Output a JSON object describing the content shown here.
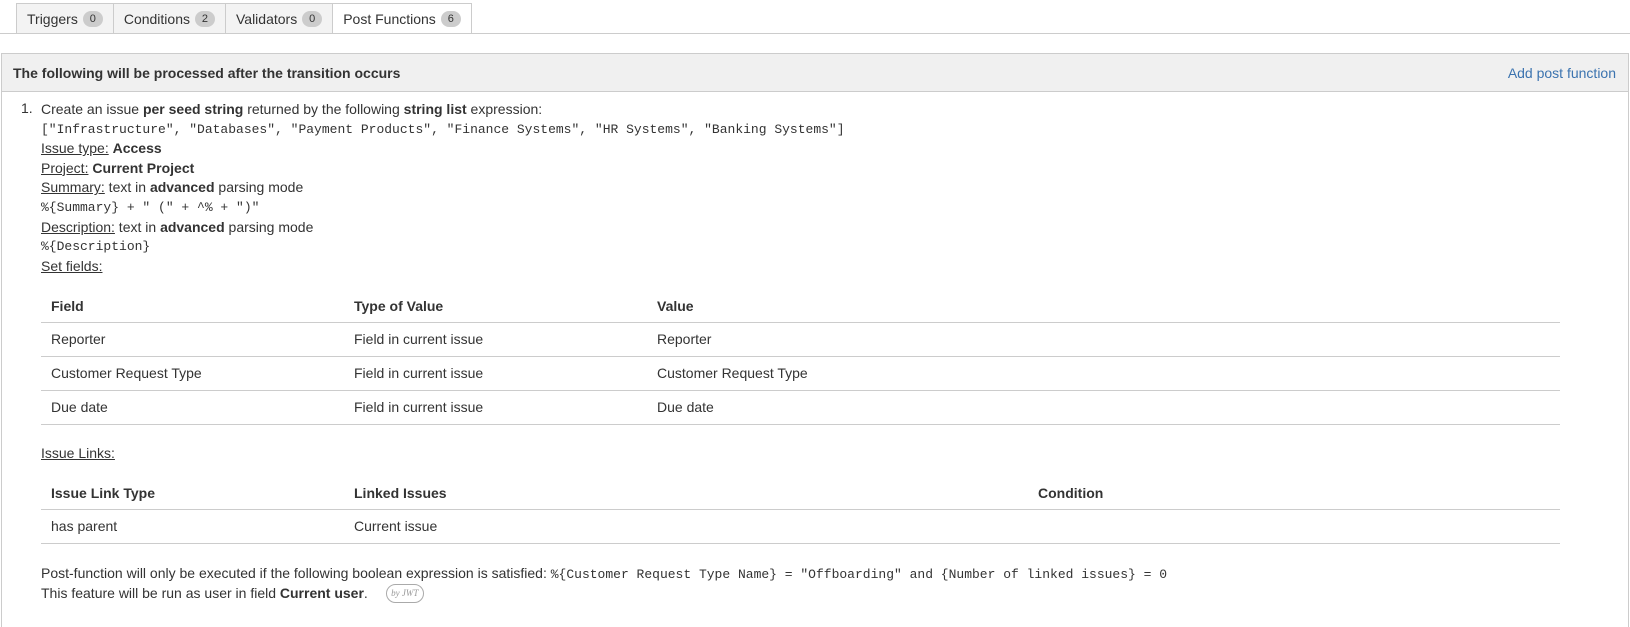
{
  "tabs": [
    {
      "label": "Triggers",
      "count": "0"
    },
    {
      "label": "Conditions",
      "count": "2"
    },
    {
      "label": "Validators",
      "count": "0"
    },
    {
      "label": "Post Functions",
      "count": "6"
    }
  ],
  "panel": {
    "title": "The following will be processed after the transition occurs",
    "add_link": "Add post function"
  },
  "item": {
    "number": "1.",
    "intro": {
      "a": "Create an issue ",
      "b": "per seed string",
      "c": " returned by the following ",
      "d": "string list",
      "e": " expression:"
    },
    "seed_expression": "[\"Infrastructure\", \"Databases\", \"Payment Products\", \"Finance Systems\", \"HR Systems\", \"Banking Systems\"]",
    "issue_type_label": "Issue type:",
    "issue_type_value": "Access",
    "project_label": "Project:",
    "project_value": "Current Project",
    "summary_label": "Summary:",
    "summary_text_a": " text in ",
    "summary_text_b": "advanced",
    "summary_text_c": " parsing mode",
    "summary_expr": "%{Summary} + \" (\" + ^% + \")\"",
    "description_label": "Description:",
    "description_text_a": " text in ",
    "description_text_b": "advanced",
    "description_text_c": " parsing mode",
    "description_expr": "%{Description}",
    "set_fields_label": "Set fields:",
    "fields_table": {
      "headers": [
        "Field",
        "Type of Value",
        "Value"
      ],
      "rows": [
        [
          "Reporter",
          "Field in current issue",
          "Reporter"
        ],
        [
          "Customer Request Type",
          "Field in current issue",
          "Customer Request Type"
        ],
        [
          "Due date",
          "Field in current issue",
          "Due date"
        ]
      ]
    },
    "issue_links_label": "Issue Links:",
    "links_table": {
      "headers": [
        "Issue Link Type",
        "Linked Issues",
        "Condition"
      ],
      "rows": [
        [
          "has parent",
          "Current issue",
          ""
        ]
      ]
    },
    "condition_text": "Post-function will only be executed if the following boolean expression is satisfied: ",
    "condition_expr": "%{Customer Request Type Name} = \"Offboarding\" and {Number of linked issues} = 0",
    "run_as_a": "This feature will be run as user in field ",
    "run_as_b": "Current user",
    "run_as_c": ".",
    "jwt_badge": "by JWT"
  }
}
